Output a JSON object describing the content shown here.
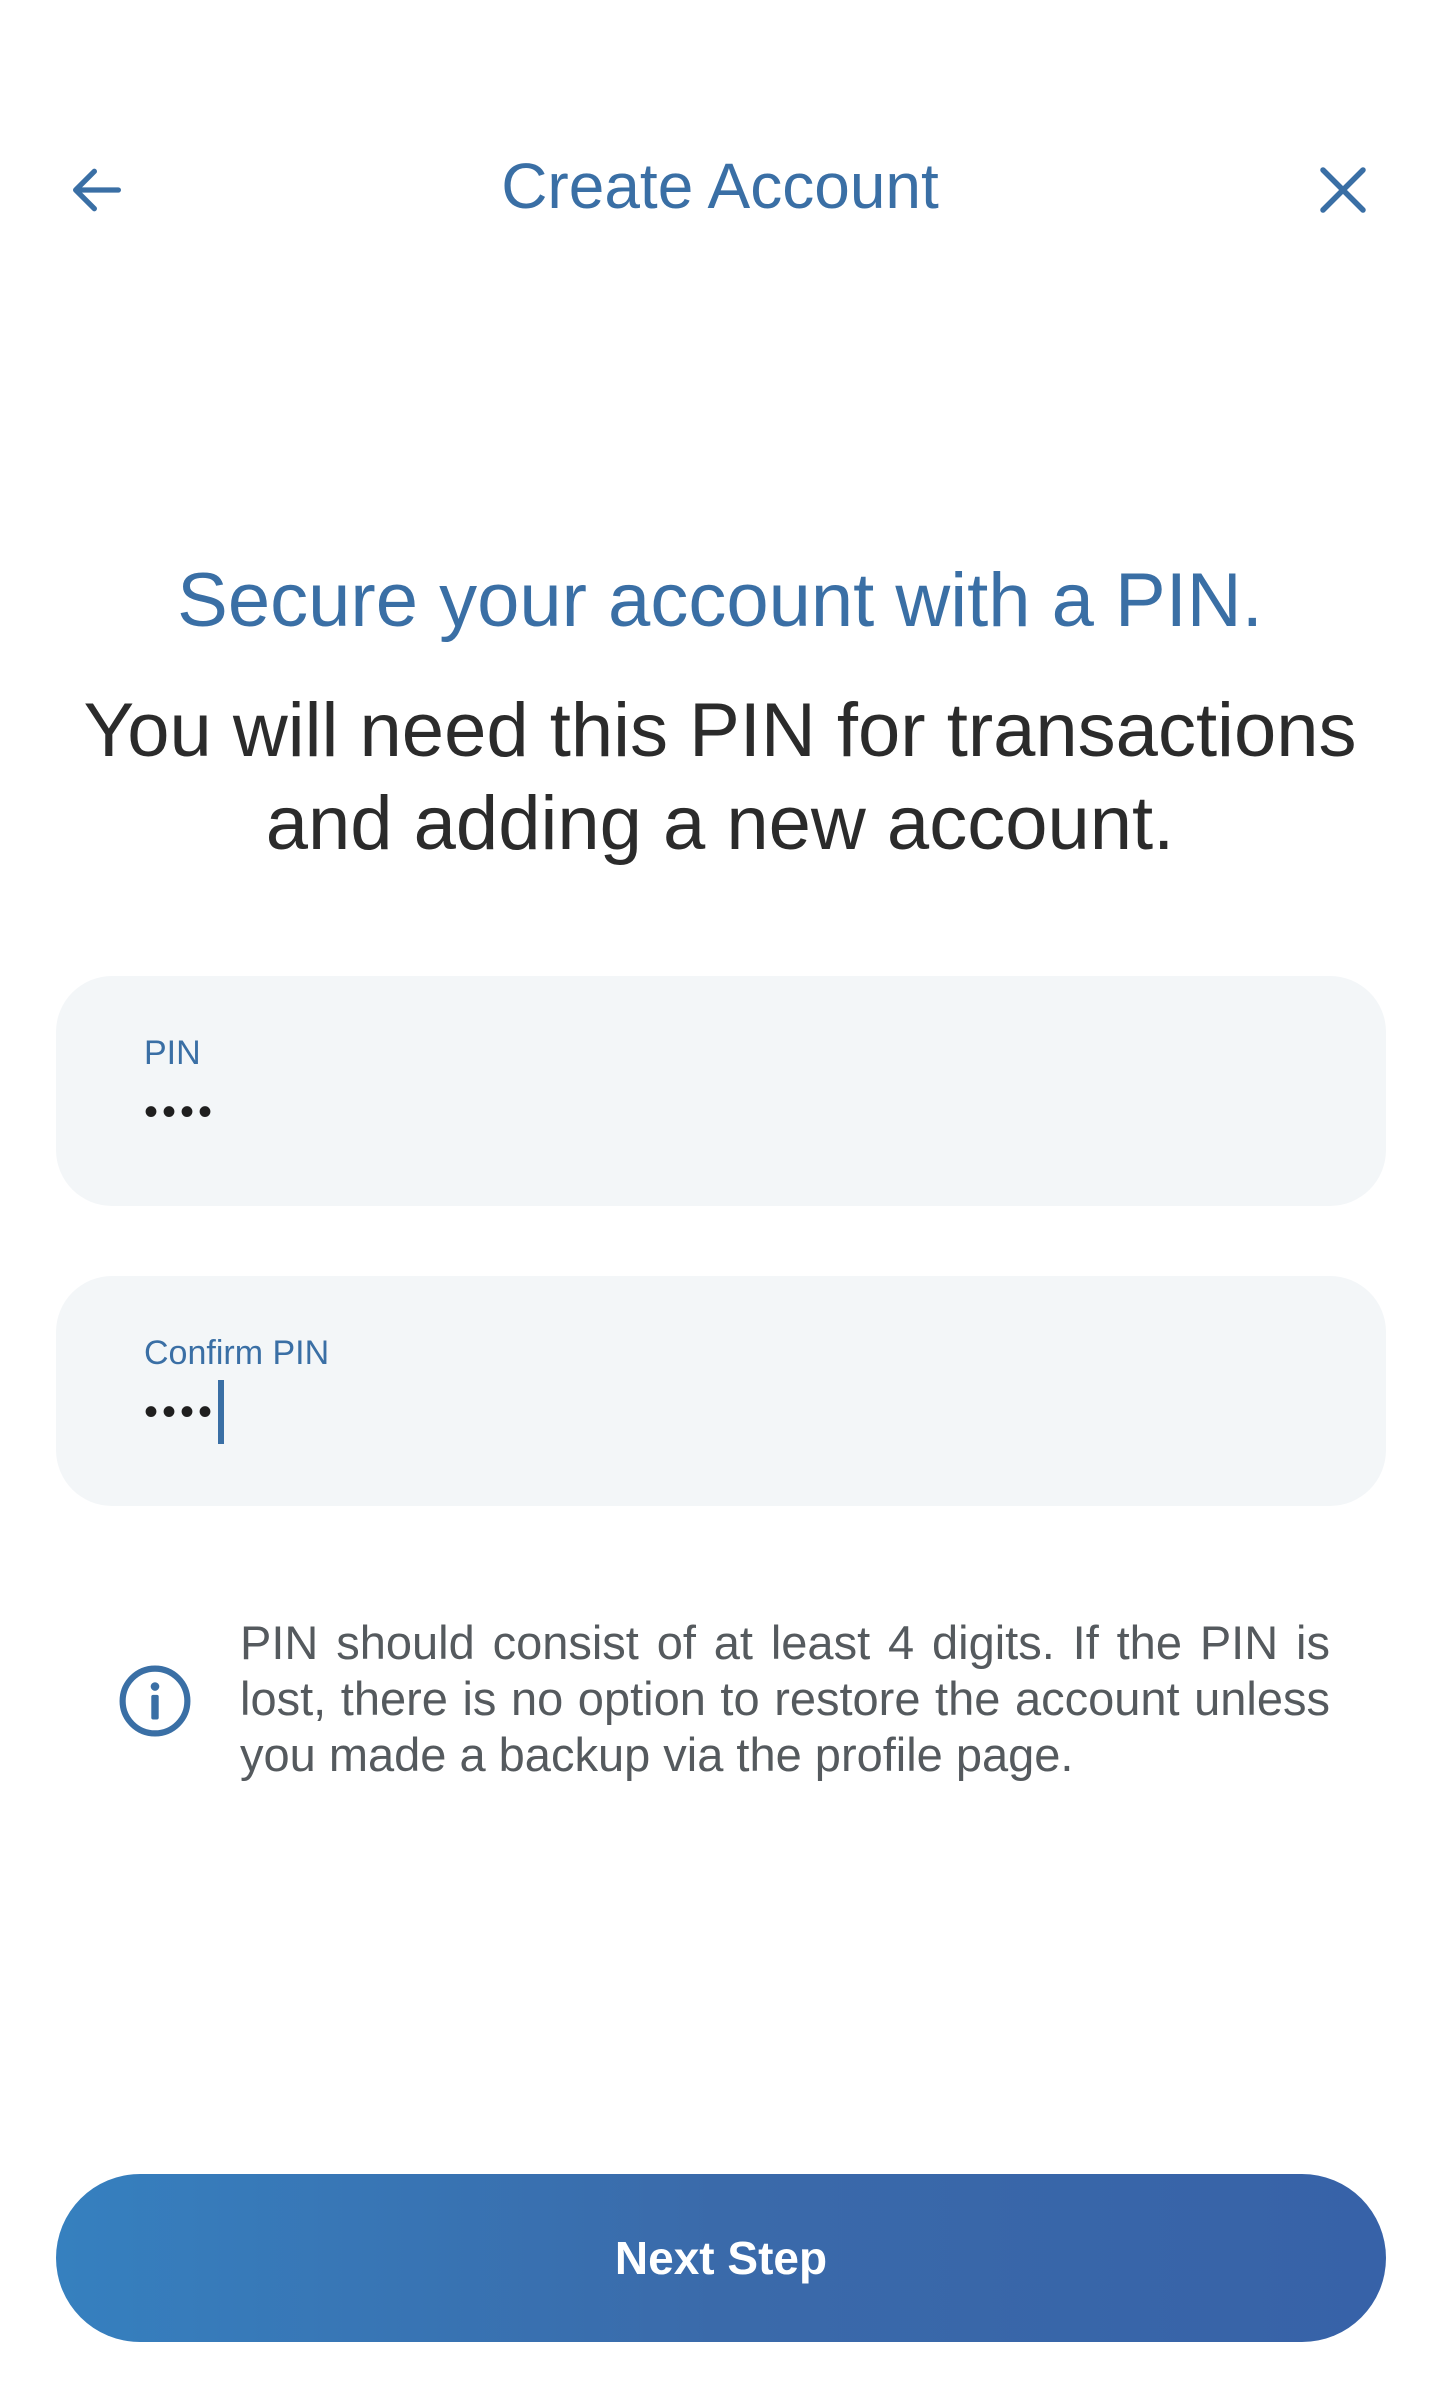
{
  "header": {
    "title": "Create Account",
    "back_icon": "arrow-left-icon",
    "close_icon": "close-icon"
  },
  "intro": {
    "headline": "Secure your account with a PIN.",
    "subtext": "You will need this PIN for transactions and adding a new account."
  },
  "form": {
    "pin": {
      "label": "PIN",
      "value": "••••"
    },
    "confirm_pin": {
      "label": "Confirm PIN",
      "value": "••••"
    }
  },
  "info": {
    "icon": "info-icon",
    "text": "PIN should consist of at least 4 digits. If the PIN is lost, there is no option to restore the account unless you made a backup via the profile page."
  },
  "actions": {
    "next_label": "Next Step"
  },
  "colors": {
    "accent": "#3a6fa5",
    "field_bg": "#f3f6f8",
    "button_gradient_start": "#3680bf",
    "button_gradient_end": "#3762a8"
  }
}
